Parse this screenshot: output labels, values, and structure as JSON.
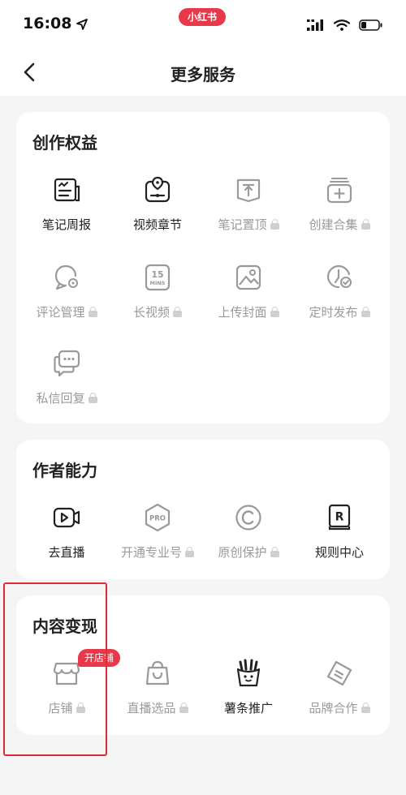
{
  "status_bar": {
    "time": "16:08",
    "app_label": "小红书"
  },
  "nav": {
    "title": "更多服务"
  },
  "sections": {
    "creation": {
      "title": "创作权益",
      "items": [
        {
          "label": "笔记周报",
          "icon": "note-report-icon",
          "locked": false
        },
        {
          "label": "视频章节",
          "icon": "video-chapter-icon",
          "locked": false
        },
        {
          "label": "笔记置顶",
          "icon": "pin-note-icon",
          "locked": true
        },
        {
          "label": "创建合集",
          "icon": "create-collection-icon",
          "locked": true
        },
        {
          "label": "评论管理",
          "icon": "comment-manage-icon",
          "locked": true
        },
        {
          "label": "长视频",
          "icon": "long-video-icon",
          "locked": true
        },
        {
          "label": "上传封面",
          "icon": "upload-cover-icon",
          "locked": true
        },
        {
          "label": "定时发布",
          "icon": "scheduled-publish-icon",
          "locked": true
        },
        {
          "label": "私信回复",
          "icon": "message-reply-icon",
          "locked": true
        }
      ],
      "long_video_icon_text_top": "15",
      "long_video_icon_text_bottom": "MINS"
    },
    "author": {
      "title": "作者能力",
      "items": [
        {
          "label": "去直播",
          "icon": "live-camera-icon",
          "locked": false
        },
        {
          "label": "开通专业号",
          "icon": "pro-account-icon",
          "locked": true
        },
        {
          "label": "原创保护",
          "icon": "copyright-icon",
          "locked": true
        },
        {
          "label": "规则中心",
          "icon": "rules-icon",
          "locked": false
        }
      ],
      "pro_icon_text": "PRO",
      "rules_icon_text": "R"
    },
    "monetize": {
      "title": "内容变现",
      "items": [
        {
          "label": "店铺",
          "icon": "shop-icon",
          "locked": true,
          "badge": "开店铺"
        },
        {
          "label": "直播选品",
          "icon": "shopping-bag-icon",
          "locked": true
        },
        {
          "label": "薯条推广",
          "icon": "fries-icon",
          "locked": false
        },
        {
          "label": "品牌合作",
          "icon": "brand-tag-icon",
          "locked": true
        }
      ]
    }
  },
  "colors": {
    "accent": "#e8384a",
    "card_bg": "#ffffff",
    "page_bg": "#f5f5f5",
    "text_dark": "#222222",
    "text_dim": "#9a9a9a",
    "highlight": "#e02b36"
  }
}
